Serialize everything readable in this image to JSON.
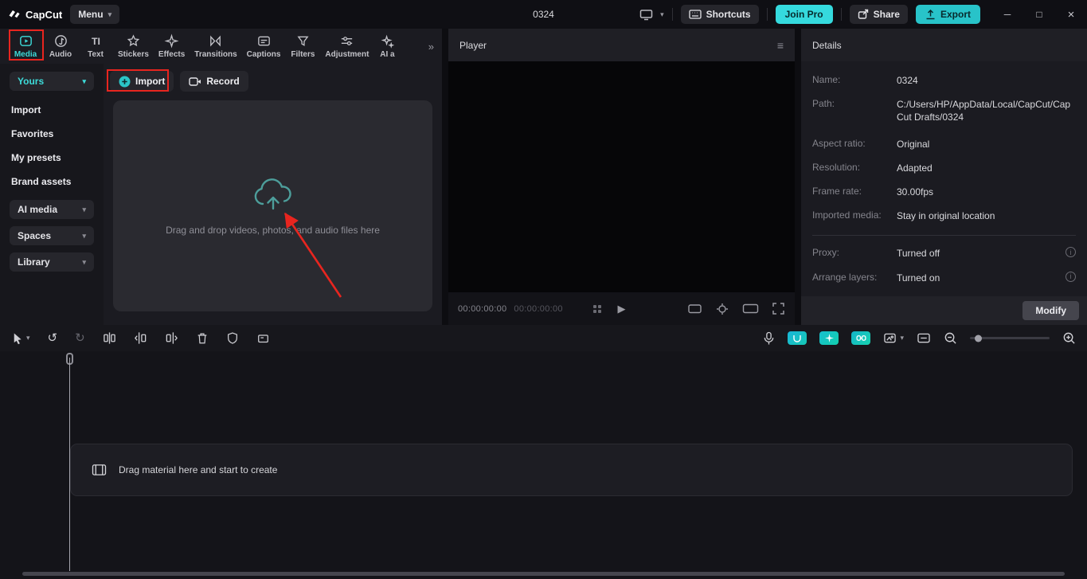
{
  "app": {
    "logo_text": "CapCut",
    "menu_label": "Menu",
    "title": "0324",
    "shortcuts_label": "Shortcuts",
    "join_pro_label": "Join Pro",
    "share_label": "Share",
    "export_label": "Export"
  },
  "icons": {
    "caret_down": "▾",
    "more_tabs": "»",
    "hamburger": "≡",
    "minimize": "─",
    "maximize": "□",
    "close": "×",
    "undo": "↺",
    "redo": "↻",
    "play": "▶",
    "info": "i",
    "text_tab_glyph": "TI"
  },
  "media_tabs": [
    {
      "label": "Media"
    },
    {
      "label": "Audio"
    },
    {
      "label": "Text"
    },
    {
      "label": "Stickers"
    },
    {
      "label": "Effects"
    },
    {
      "label": "Transitions"
    },
    {
      "label": "Captions"
    },
    {
      "label": "Filters"
    },
    {
      "label": "Adjustment"
    },
    {
      "label": "AI a"
    }
  ],
  "sidebar": {
    "items": [
      {
        "label": "Yours"
      },
      {
        "label": "Import"
      },
      {
        "label": "Favorites"
      },
      {
        "label": "My presets"
      },
      {
        "label": "Brand assets"
      },
      {
        "label": "AI media"
      },
      {
        "label": "Spaces"
      },
      {
        "label": "Library"
      }
    ]
  },
  "media_panel": {
    "import_label": "Import",
    "record_label": "Record",
    "dropzone_text": "Drag and drop videos, photos, and audio files here"
  },
  "player": {
    "title": "Player",
    "timecode_current": "00:00:00:00",
    "timecode_duration": "00:00:00:00"
  },
  "details": {
    "title": "Details",
    "fields": [
      {
        "label": "Name:",
        "value": "0324"
      },
      {
        "label": "Path:",
        "value": "C:/Users/HP/AppData/Local/CapCut/CapCut Drafts/0324"
      },
      {
        "label": "Aspect ratio:",
        "value": "Original"
      },
      {
        "label": "Resolution:",
        "value": "Adapted"
      },
      {
        "label": "Frame rate:",
        "value": "30.00fps"
      },
      {
        "label": "Imported media:",
        "value": "Stay in original location"
      }
    ],
    "toggles": [
      {
        "label": "Proxy:",
        "value": "Turned off"
      },
      {
        "label": "Arrange layers:",
        "value": "Turned on"
      }
    ],
    "modify_label": "Modify"
  },
  "timeline": {
    "empty_text": "Drag material here and start to create"
  },
  "colors": {
    "accent": "#3ddbd9",
    "export_bg": "#28c3c9",
    "annotation_red": "#e8251f"
  }
}
